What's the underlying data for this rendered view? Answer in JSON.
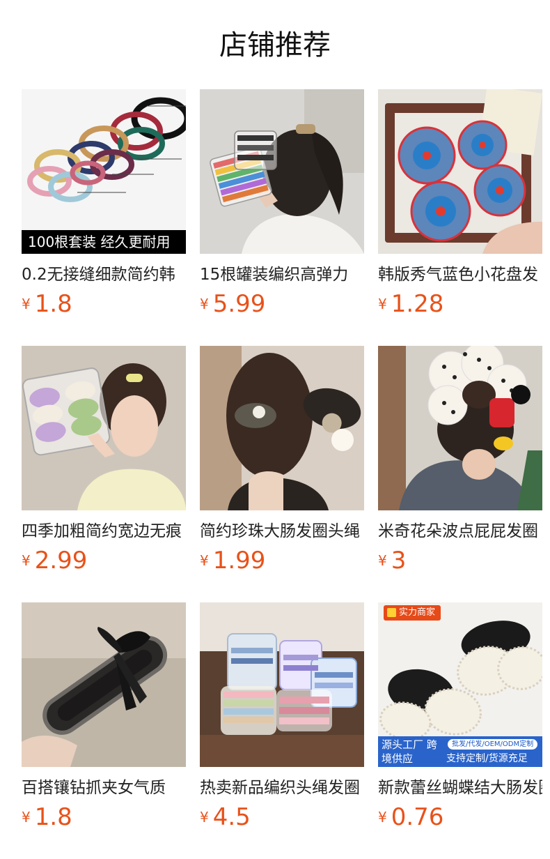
{
  "page": {
    "title": "店铺推荐"
  },
  "products": [
    {
      "title": "0.2无接缝细款简约韩",
      "currency": "¥",
      "price": "1.8",
      "overlay": "100根套装 经久更耐用"
    },
    {
      "title": "15根罐装编织高弹力",
      "currency": "¥",
      "price": "5.99"
    },
    {
      "title": "韩版秀气蓝色小花盘发",
      "currency": "¥",
      "price": "1.28"
    },
    {
      "title": "四季加粗简约宽边无痕",
      "currency": "¥",
      "price": "2.99"
    },
    {
      "title": "简约珍珠大肠发圈头绳",
      "currency": "¥",
      "price": "1.99"
    },
    {
      "title": "米奇花朵波点屁屁发圈",
      "currency": "¥",
      "price": "3"
    },
    {
      "title": "百搭镶钻抓夹女气质",
      "currency": "¥",
      "price": "1.8"
    },
    {
      "title": "热卖新品编织头绳发圈",
      "currency": "¥",
      "price": "4.5"
    },
    {
      "title": "新款蕾丝蝴蝶结大肠发圈",
      "currency": "¥",
      "price": "0.76",
      "badge": "实力商家",
      "factory_left": "源头工厂 跨境供应",
      "factory_tag": "批发/代发/OEM/ODM定制",
      "factory_right": "支持定制/货源充足"
    }
  ],
  "colors": {
    "price": "#e8521a",
    "badge": "#e64a19",
    "factory_bar": "#1958c8"
  }
}
